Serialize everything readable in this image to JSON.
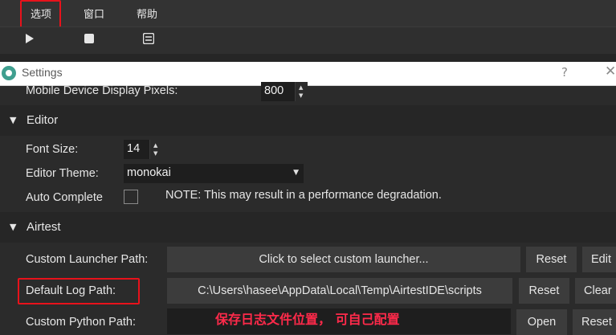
{
  "menubar": {
    "items": [
      {
        "label": "选项"
      },
      {
        "label": "窗口"
      },
      {
        "label": "帮助"
      }
    ]
  },
  "toolbar": {
    "icons": [
      "play-icon",
      "stop-icon",
      "list-icon"
    ]
  },
  "dialog": {
    "title": "Settings",
    "help_label": "?",
    "close_label": "✕"
  },
  "settings": {
    "mobile_display_pixels": {
      "label": "Mobile Device Display Pixels:",
      "value": "800"
    },
    "editor": {
      "section_title": "Editor",
      "font_size": {
        "label": "Font Size:",
        "value": "14"
      },
      "theme": {
        "label": "Editor Theme:",
        "value": "monokai"
      },
      "auto_complete": {
        "label": "Auto Complete",
        "checked": false,
        "note": "NOTE: This may result in a performance degradation."
      }
    },
    "airtest": {
      "section_title": "Airtest",
      "custom_launcher": {
        "label": "Custom Launcher Path:",
        "value": "Click to select custom launcher...",
        "reset": "Reset",
        "edit": "Edit"
      },
      "default_log_path": {
        "label": "Default Log Path:",
        "value": "C:\\Users\\hasee\\AppData\\Local\\Temp\\AirtestIDE\\scripts",
        "reset": "Reset",
        "clear": "Clear"
      },
      "custom_python": {
        "label": "Custom Python Path:",
        "value": "",
        "open": "Open",
        "reset": "Reset"
      }
    }
  },
  "annotation": {
    "text": "保存日志文件位置，  可自己配置"
  },
  "colors": {
    "highlight": "#e8121b",
    "annotation": "#ff2a4a",
    "accent": "#3f9f8f"
  }
}
